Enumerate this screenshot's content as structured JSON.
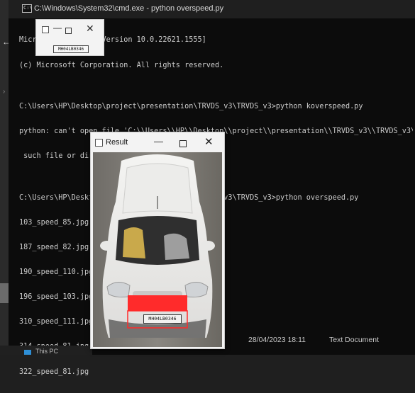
{
  "cmd_window": {
    "title": "C:\\Windows\\System32\\cmd.exe - python  overspeed.py",
    "icon": "cmd-icon",
    "lines": [
      "Microsoft Windows [Version 10.0.22621.1555]",
      "(c) Microsoft Corporation. All rights reserved.",
      "",
      "C:\\Users\\HP\\Desktop\\project\\presentation\\TRVDS_v3\\TRVDS_v3>python koverspeed.py",
      "python: can't open file 'C:\\\\Users\\\\HP\\\\Desktop\\\\project\\\\presentation\\\\TRVDS_v3\\\\TRVDS_v3\\\\koverspeed.py': [Errno 2] No",
      " such file or directory",
      "",
      "C:\\Users\\HP\\Desktop\\project\\presentation\\TRVDS_v3\\TRVDS_v3>python overspeed.py",
      "103_speed_85.jpg",
      "187_speed_82.jpg",
      "190_speed_110.jpg",
      "196_speed_103.jpg",
      "310_speed_111.jpg",
      "314_speed_81.jpg",
      "322_speed_81.jpg"
    ]
  },
  "plate_window": {
    "plate_text": "MH04LB0346",
    "icons": [
      "app-icon",
      "minimize-icon",
      "maximize-icon",
      "close-icon"
    ]
  },
  "result_window": {
    "title": "Result",
    "plate_text": "MH04LB0346",
    "highlight_color": "#ff2b2b",
    "icons": [
      "app-icon",
      "minimize-icon",
      "maximize-icon",
      "close-icon"
    ]
  },
  "explorer_row": {
    "date_modified": "28/04/2023 18:11",
    "type": "Text Document",
    "folder_label": "This PC"
  }
}
